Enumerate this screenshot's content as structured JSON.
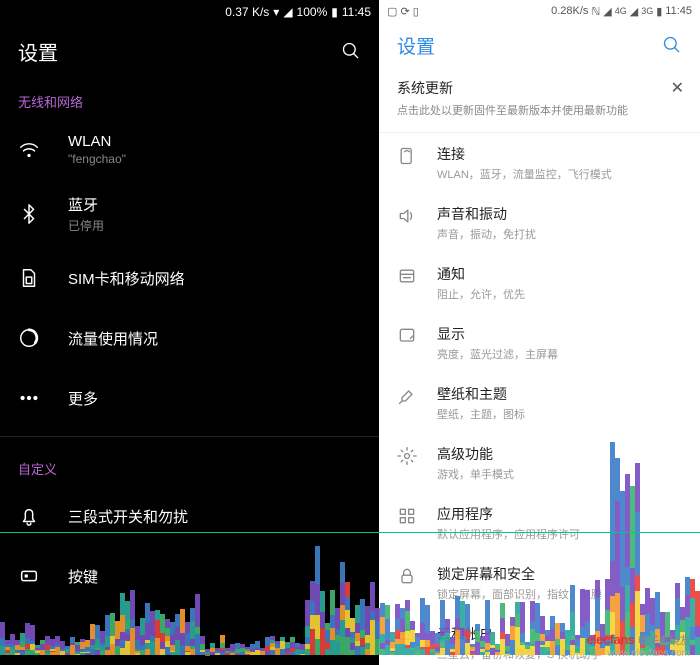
{
  "left": {
    "statusbar": {
      "speed": "0.37 K/s",
      "battery": "100%",
      "time": "11:45"
    },
    "header": {
      "title": "设置"
    },
    "section1_label": "无线和网络",
    "items1": [
      {
        "name": "wlan",
        "label": "WLAN",
        "sub": "\"fengchao\""
      },
      {
        "name": "bluetooth",
        "label": "蓝牙",
        "sub": "已停用"
      },
      {
        "name": "sim",
        "label": "SIM卡和移动网络",
        "sub": ""
      },
      {
        "name": "data",
        "label": "流量使用情况",
        "sub": ""
      },
      {
        "name": "more",
        "label": "更多",
        "sub": ""
      }
    ],
    "section2_label": "自定义",
    "items2": [
      {
        "name": "slider",
        "label": "三段式开关和勿扰",
        "sub": ""
      },
      {
        "name": "keys",
        "label": "按键",
        "sub": ""
      }
    ]
  },
  "right": {
    "statusbar": {
      "speed": "0.28K/s",
      "time": "11:45"
    },
    "header": {
      "title": "设置"
    },
    "update": {
      "title": "系统更新",
      "sub": "点击此处以更新固件至最新版本并使用最新功能"
    },
    "items": [
      {
        "name": "connections",
        "label": "连接",
        "sub": "WLAN，蓝牙，流量监控，飞行模式"
      },
      {
        "name": "sound",
        "label": "声音和振动",
        "sub": "声音，振动，免打扰"
      },
      {
        "name": "notifications",
        "label": "通知",
        "sub": "阻止，允许，优先"
      },
      {
        "name": "display",
        "label": "显示",
        "sub": "亮度，蓝光过滤，主屏幕"
      },
      {
        "name": "wallpaper",
        "label": "壁纸和主题",
        "sub": "壁纸，主题，图标"
      },
      {
        "name": "advanced",
        "label": "高级功能",
        "sub": "游戏，单手模式"
      },
      {
        "name": "apps",
        "label": "应用程序",
        "sub": "默认应用程序，应用程序许可"
      },
      {
        "name": "lock",
        "label": "锁定屏幕和安全",
        "sub": "锁定屏幕，面部识别，指纹，虹膜"
      },
      {
        "name": "cloud",
        "label": "云和帐户",
        "sub": "三星云，备份和恢复，S 换机助手"
      }
    ]
  },
  "watermark": {
    "brand": "elecfans",
    "cn": "电子发烧友",
    "url": "www.elecfans.com"
  },
  "chart_data": {
    "type": "bar",
    "note": "Decorative stacked histogram overlay (CPU/process usage style), approximate pixel heights",
    "colors": {
      "red": "#e8413a",
      "orange": "#f59a2e",
      "yellow": "#f2d435",
      "green": "#3fb571",
      "teal": "#2aa89a",
      "blue": "#3f7fc9",
      "purple": "#7a4fc1"
    }
  }
}
